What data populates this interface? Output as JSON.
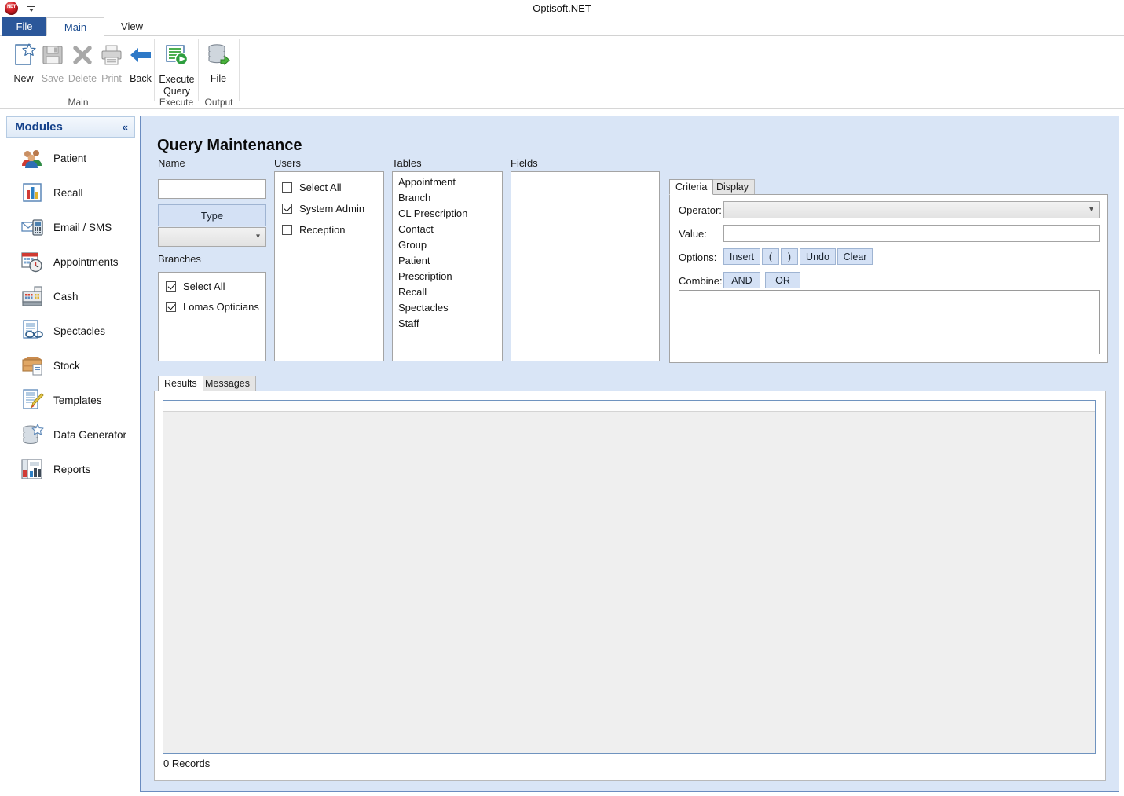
{
  "window": {
    "title": "Optisoft.NET",
    "quick_access": [
      "net-orb-icon",
      "customize-quick-access-icon"
    ]
  },
  "ribbon": {
    "tabs": [
      {
        "label": "File",
        "active": false,
        "style": "file"
      },
      {
        "label": "Main",
        "active": true,
        "style": "normal"
      },
      {
        "label": "View",
        "active": false,
        "style": "normal"
      }
    ],
    "groups": [
      {
        "name": "Main",
        "label": "Main",
        "buttons": [
          {
            "label": "New",
            "icon": "new-document-icon",
            "enabled": true
          },
          {
            "label": "Save",
            "icon": "floppy-disk-icon",
            "enabled": false
          },
          {
            "label": "Delete",
            "icon": "x-cross-icon",
            "enabled": false
          },
          {
            "label": "Print",
            "icon": "printer-icon",
            "enabled": false
          },
          {
            "label": "Back",
            "icon": "left-arrow-icon",
            "enabled": true
          }
        ]
      },
      {
        "name": "Execute",
        "label": "Execute",
        "buttons": [
          {
            "label": "Execute Query",
            "icon": "execute-query-icon",
            "enabled": true
          }
        ]
      },
      {
        "name": "Output",
        "label": "Output",
        "buttons": [
          {
            "label": "File",
            "icon": "database-export-icon",
            "enabled": true
          }
        ]
      }
    ]
  },
  "sidebar": {
    "header": "Modules",
    "collapse_glyph": "«",
    "items": [
      {
        "label": "Patient",
        "icon": "people-icon"
      },
      {
        "label": "Recall",
        "icon": "bar-chart-icon"
      },
      {
        "label": "Email / SMS",
        "icon": "email-phone-icon"
      },
      {
        "label": "Appointments",
        "icon": "calendar-clock-icon"
      },
      {
        "label": "Cash",
        "icon": "cash-register-icon"
      },
      {
        "label": "Spectacles",
        "icon": "glasses-icon"
      },
      {
        "label": "Stock",
        "icon": "stock-box-icon"
      },
      {
        "label": "Templates",
        "icon": "document-pencil-icon"
      },
      {
        "label": "Data Generator",
        "icon": "database-star-icon"
      },
      {
        "label": "Reports",
        "icon": "reports-chart-icon"
      }
    ]
  },
  "main": {
    "title": "Query Maintenance",
    "name_section": {
      "label": "Name",
      "name_value": "",
      "name_placeholder": "",
      "type_button": "Type",
      "type_combo_value": ""
    },
    "branches": {
      "label": "Branches",
      "items": [
        {
          "label": "Select All",
          "checked": true
        },
        {
          "label": "Lomas Opticians",
          "checked": true
        }
      ]
    },
    "users": {
      "label": "Users",
      "items": [
        {
          "label": "Select All",
          "checked": false
        },
        {
          "label": "System Admin",
          "checked": true
        },
        {
          "label": "Reception",
          "checked": false
        }
      ]
    },
    "tables": {
      "label": "Tables",
      "items": [
        "Appointment",
        "Branch",
        "CL Prescription",
        "Contact",
        "Group",
        "Patient",
        "Prescription",
        "Recall",
        "Spectacles",
        "Staff"
      ]
    },
    "fields": {
      "label": "Fields",
      "items": []
    },
    "criteria_panel": {
      "tabs": [
        {
          "label": "Criteria",
          "active": true
        },
        {
          "label": "Display",
          "active": false
        }
      ],
      "operator_label": "Operator:",
      "operator_value": "",
      "value_label": "Value:",
      "value_value": "",
      "options_label": "Options:",
      "option_buttons": [
        "Insert",
        "(",
        ")",
        "Undo",
        "Clear"
      ],
      "combine_label": "Combine:",
      "combine_buttons": [
        "AND",
        "OR"
      ],
      "expression_value": ""
    },
    "results_panel": {
      "tabs": [
        {
          "label": "Results",
          "active": true
        },
        {
          "label": "Messages",
          "active": false
        }
      ],
      "status": "0 Records"
    }
  },
  "colors": {
    "accent_blue": "#2b579a",
    "panel_blue": "#d9e5f6",
    "button_blue": "#d4e1f5",
    "module_header_text": "#15428b"
  }
}
